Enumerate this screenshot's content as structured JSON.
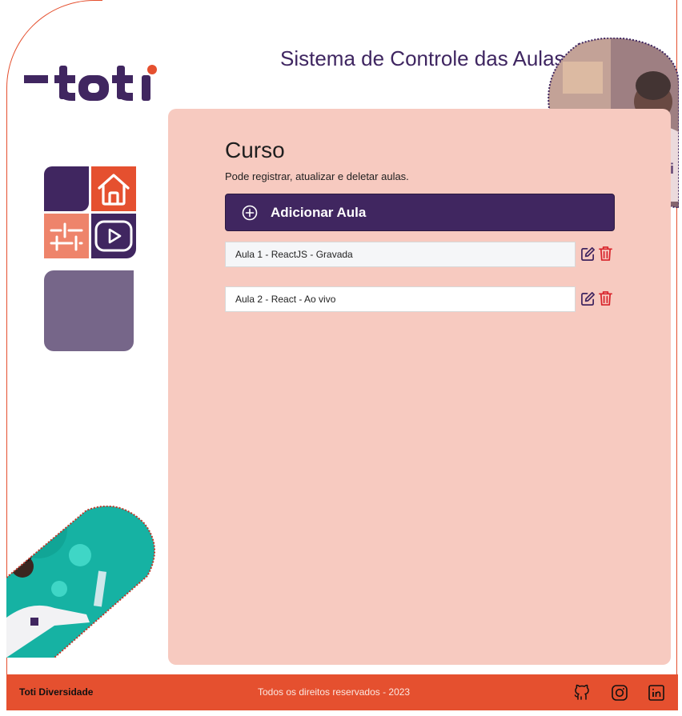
{
  "header": {
    "title": "Sistema de Controle das Aulas",
    "logo_text": "-toti",
    "logo_accent_color": "#e5502f",
    "brand_color": "#402660"
  },
  "sidebar": {
    "tiles": [
      {
        "icon": "blank-tile"
      },
      {
        "icon": "home-icon"
      },
      {
        "icon": "sliders-icon"
      },
      {
        "icon": "video-play-icon"
      }
    ]
  },
  "main": {
    "title": "Curso",
    "description": "Pode registrar, atualizar e deletar aulas.",
    "add_button_label": "Adicionar Aula",
    "lessons": [
      {
        "label": "Aula 1 - ReactJS - Gravada"
      },
      {
        "label": "Aula 2 - React - Ao vivo"
      }
    ]
  },
  "footer": {
    "brand": "Toti Diversidade",
    "copyright": "Todos os direitos reservados - 2023",
    "social": [
      "github-icon",
      "instagram-icon",
      "linkedin-icon"
    ]
  },
  "colors": {
    "primary": "#402660",
    "accent": "#e5502f",
    "panel": "#f7cac0",
    "danger": "#d8232a"
  }
}
